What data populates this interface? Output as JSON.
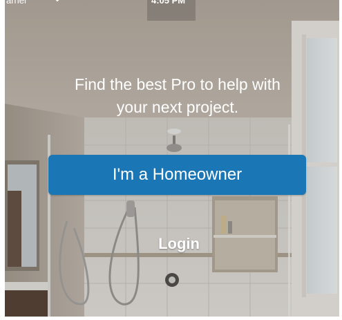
{
  "status_bar": {
    "carrier": "arner",
    "time": "4:05 PM"
  },
  "hero": {
    "headline_line1": "Find the best Pro to help with",
    "headline_line2": "your next project."
  },
  "actions": {
    "homeowner_label": "I'm a Homeowner",
    "login_label": "Login"
  },
  "colors": {
    "primary_button": "#1a76b4",
    "text": "#ffffff"
  },
  "icons": {
    "carrier": "chevron-down-icon",
    "background": "bathroom-photo"
  }
}
